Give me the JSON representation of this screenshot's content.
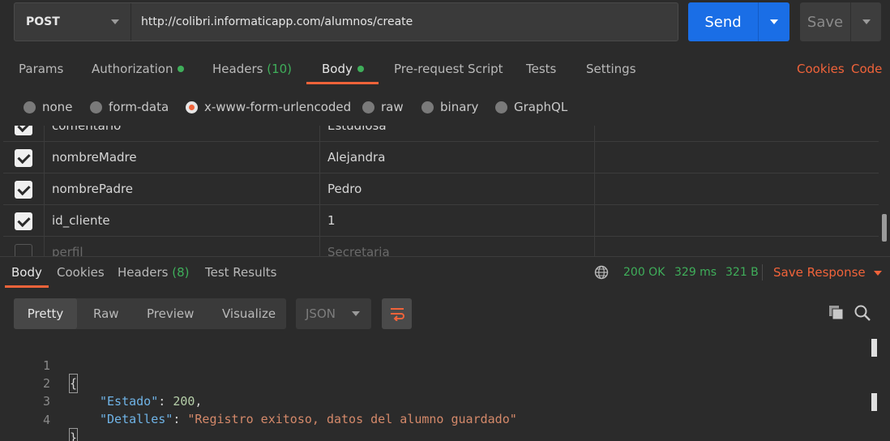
{
  "request": {
    "method": "POST",
    "url": "http://colibri.informaticapp.com/alumnos/create",
    "send_label": "Send",
    "save_label": "Save"
  },
  "request_tabs": {
    "params": "Params",
    "authorization": "Authorization",
    "headers": "Headers",
    "headers_count": "(10)",
    "body": "Body",
    "pre_request": "Pre-request Script",
    "tests": "Tests",
    "settings": "Settings",
    "cookies": "Cookies",
    "code": "Code"
  },
  "body_types": {
    "none": "none",
    "form_data": "form-data",
    "urlencoded": "x-www-form-urlencoded",
    "raw": "raw",
    "binary": "binary",
    "graphql": "GraphQL",
    "selected": "x-www-form-urlencoded"
  },
  "params_rows": [
    {
      "checked": true,
      "key": "comentario",
      "value": "Estudiosa"
    },
    {
      "checked": true,
      "key": "nombreMadre",
      "value": "Alejandra"
    },
    {
      "checked": true,
      "key": "nombrePadre",
      "value": "Pedro"
    },
    {
      "checked": true,
      "key": "id_cliente",
      "value": "1"
    },
    {
      "checked": false,
      "key": "perfil",
      "value": "Secretaria"
    }
  ],
  "response_tabs": {
    "body": "Body",
    "cookies": "Cookies",
    "headers": "Headers",
    "headers_count": "(8)",
    "test_results": "Test Results"
  },
  "response_status": {
    "status": "200 OK",
    "time": "329 ms",
    "size": "321 B",
    "save_response": "Save Response"
  },
  "response_view": {
    "pretty": "Pretty",
    "raw": "Raw",
    "preview": "Preview",
    "visualize": "Visualize",
    "format": "JSON"
  },
  "response_body": {
    "line_numbers": [
      "1",
      "2",
      "3",
      "4"
    ],
    "open_brace": "{",
    "close_brace": "}",
    "key1": "\"Estado\"",
    "val1": "200",
    "key2": "\"Detalles\"",
    "val2": "\"Registro exitoso, datos del alumno guardado\""
  },
  "icons": {
    "globe": "globe-icon",
    "wrap": "wrap-lines-icon",
    "copy": "copy-icon",
    "search": "search-icon"
  },
  "colors": {
    "accent": "#f0633a",
    "send": "#1a6ee6",
    "success": "#3fae5a"
  }
}
